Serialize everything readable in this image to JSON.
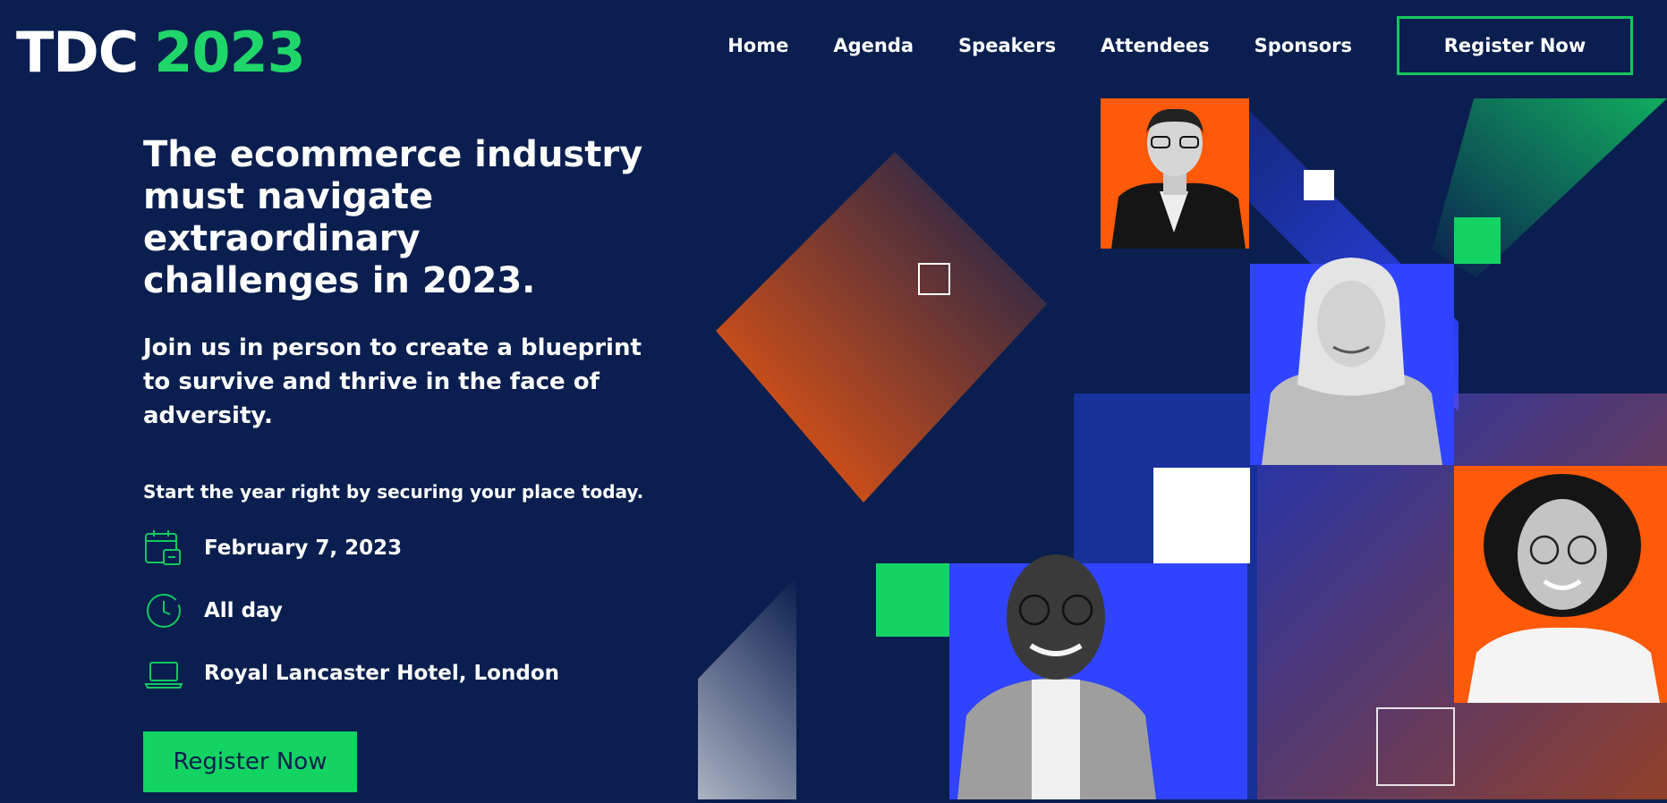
{
  "logo": {
    "left": "TDC",
    "right": "2023"
  },
  "nav": {
    "items": [
      {
        "label": "Home"
      },
      {
        "label": "Agenda"
      },
      {
        "label": "Speakers"
      },
      {
        "label": "Attendees"
      },
      {
        "label": "Sponsors"
      }
    ],
    "register": "Register Now"
  },
  "hero": {
    "headline": "The ecommerce industry must navigate extraordinary challenges in 2023.",
    "subheadline": "Join us in person to create a blueprint to survive and thrive in the face of adversity.",
    "cta_line": "Start the year right by securing your place today.",
    "details": [
      {
        "icon": "calendar-icon",
        "text": "February 7, 2023"
      },
      {
        "icon": "clock-icon",
        "text": "All day"
      },
      {
        "icon": "laptop-icon",
        "text": "Royal Lancaster Hotel, London"
      }
    ],
    "button": "Register Now"
  },
  "colors": {
    "bg": "#0a1f4f",
    "green": "#13d463",
    "orange": "#ff5a0a",
    "blue": "#3044ff"
  }
}
